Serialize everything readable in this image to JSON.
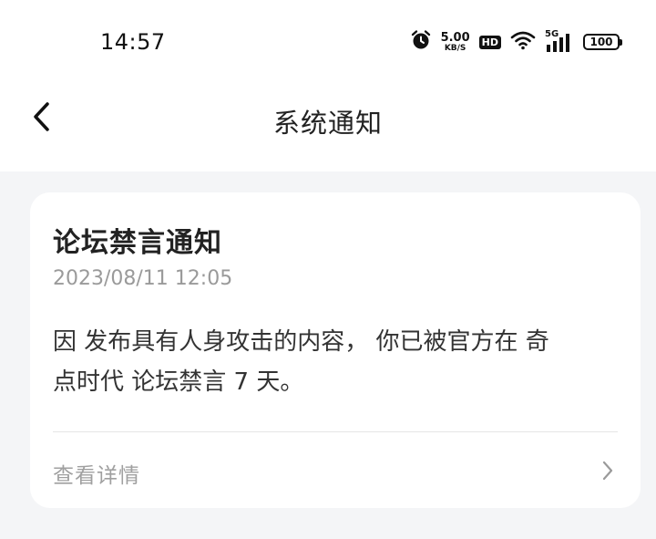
{
  "status_bar": {
    "time": "14:57",
    "net_speed_value": "5.00",
    "net_speed_unit": "KB/S",
    "hd_badge": "HD",
    "network_type": "5G",
    "battery": "100"
  },
  "nav": {
    "title": "系统通知"
  },
  "notification": {
    "title": "论坛禁言通知",
    "date": "2023/08/11 12:05",
    "body_line1": "因 发布具有人身攻击的内容， 你已被官方在 奇",
    "body_line2": "点时代 论坛禁言 7 天。",
    "detail_label": "查看详情"
  },
  "colors": {
    "background": "#f4f5f7",
    "card": "#ffffff",
    "text_primary": "#222222",
    "text_secondary": "#9a9a9a"
  },
  "icons": {
    "back": "chevron-left-icon",
    "detail": "chevron-right-icon",
    "alarm": "alarm-icon",
    "wifi": "wifi-icon",
    "signal": "signal-icon",
    "battery": "battery-icon"
  }
}
